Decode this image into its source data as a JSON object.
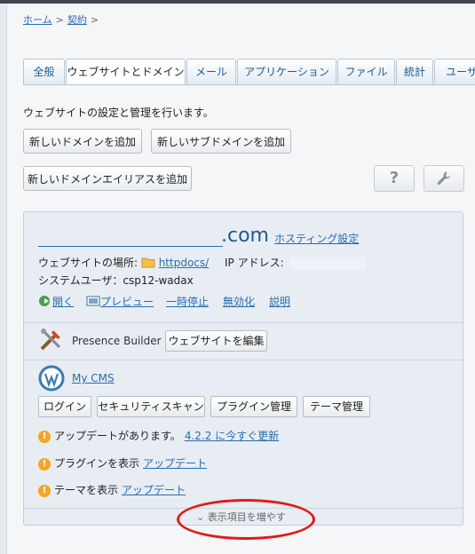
{
  "breadcrumb": {
    "home": "ホーム",
    "contract": "契約",
    "sep": ">"
  },
  "tabs": [
    "全般",
    "ウェブサイトとドメイン",
    "メール",
    "アプリケーション",
    "ファイル",
    "統計",
    "ユーザ"
  ],
  "description": "ウェブサイトの設定と管理を行います。",
  "buttons": {
    "add_domain": "新しいドメインを追加",
    "add_subdomain": "新しいサブドメインを追加",
    "add_alias": "新しいドメインエイリアスを追加",
    "help": "?"
  },
  "domain": {
    "tld": ".com",
    "hosting_settings": "ホスティング設定",
    "site_location_label": "ウェブサイトの場所:",
    "site_location_value": "httpdocs/",
    "ip_label": "IP アドレス:",
    "system_user": "システムユーザ：csp12-wadax",
    "actions": [
      "開く",
      "プレビュー",
      "一時停止",
      "無効化",
      "説明"
    ]
  },
  "presence_builder": {
    "name": "Presence Builder",
    "edit_button": "ウェブサイトを編集"
  },
  "cms": {
    "name": "My CMS",
    "buttons": [
      "ログイン",
      "セキュリティスキャン",
      "プラグイン管理",
      "テーマ管理"
    ]
  },
  "notices": [
    {
      "text": "アップデートがあります。",
      "link": "4.2.2 に今すぐ更新"
    },
    {
      "text": "プラグインを表示",
      "link": "アップデート"
    },
    {
      "text": "テーマを表示",
      "link": "アップデート"
    }
  ],
  "show_more": "表示項目を増やす",
  "colors": {
    "link": "#2a6cb0",
    "highlight": "#e01b1b",
    "warning": "#f5a623"
  }
}
